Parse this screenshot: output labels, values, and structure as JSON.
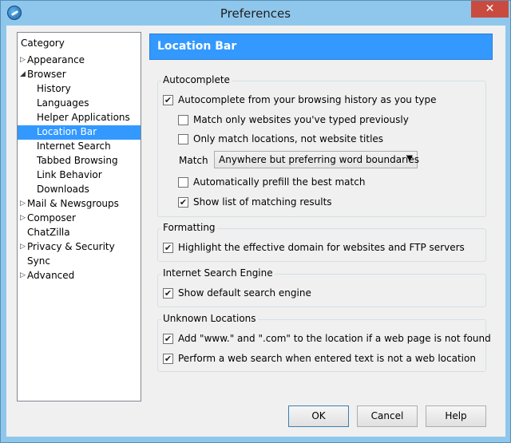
{
  "window": {
    "title": "Preferences",
    "close_glyph": "✕"
  },
  "category": {
    "header": "Category",
    "items": [
      {
        "label": "Appearance",
        "arrow": "▷"
      },
      {
        "label": "Browser",
        "arrow": "◢"
      },
      {
        "label": "History",
        "arrow": ""
      },
      {
        "label": "Languages",
        "arrow": ""
      },
      {
        "label": "Helper Applications",
        "arrow": ""
      },
      {
        "label": "Location Bar",
        "arrow": ""
      },
      {
        "label": "Internet Search",
        "arrow": ""
      },
      {
        "label": "Tabbed Browsing",
        "arrow": ""
      },
      {
        "label": "Link Behavior",
        "arrow": ""
      },
      {
        "label": "Downloads",
        "arrow": ""
      },
      {
        "label": "Mail & Newsgroups",
        "arrow": "▷"
      },
      {
        "label": "Composer",
        "arrow": "▷"
      },
      {
        "label": "ChatZilla",
        "arrow": ""
      },
      {
        "label": "Privacy & Security",
        "arrow": "▷"
      },
      {
        "label": "Sync",
        "arrow": ""
      },
      {
        "label": "Advanced",
        "arrow": "▷"
      }
    ],
    "selected": "Location Bar"
  },
  "pane": {
    "title": "Location Bar"
  },
  "autocomplete": {
    "title": "Autocomplete",
    "main": {
      "label": "Autocomplete from your browsing history as you type",
      "checked": "✔"
    },
    "typed_only": {
      "label": "Match only websites you've typed previously",
      "checked": ""
    },
    "locations_only": {
      "label": "Only match locations, not website titles",
      "checked": ""
    },
    "match_label": "Match",
    "match_value": "Anywhere but preferring word boundaries",
    "match_arrow": "▼",
    "prefill": {
      "label": "Automatically prefill the best match",
      "checked": ""
    },
    "show_list": {
      "label": "Show list of matching results",
      "checked": "✔"
    }
  },
  "formatting": {
    "title": "Formatting",
    "highlight": {
      "label": "Highlight the effective domain for websites and FTP servers",
      "checked": "✔"
    }
  },
  "search_engine": {
    "title": "Internet Search Engine",
    "show_default": {
      "label": "Show default search engine",
      "checked": "✔"
    }
  },
  "unknown": {
    "title": "Unknown Locations",
    "add_www": {
      "label": "Add \"www.\" and \".com\" to the location if a web page is not found",
      "checked": "✔"
    },
    "web_search": {
      "label": "Perform a web search when entered text is not a web location",
      "checked": "✔"
    }
  },
  "buttons": {
    "ok": "OK",
    "cancel": "Cancel",
    "help": "Help"
  },
  "colors": {
    "accent": "#3399ff",
    "titlebar": "#8fc7ec",
    "close": "#c94b3f"
  }
}
